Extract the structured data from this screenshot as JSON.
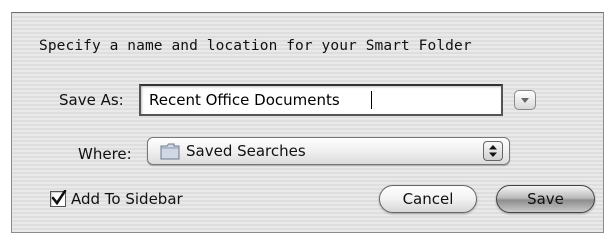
{
  "dialog": {
    "prompt": "Specify a name and location for your Smart Folder",
    "save_as": {
      "label": "Save As:",
      "value": "Recent Office Documents"
    },
    "disclosure_icon": "triangle-down-icon",
    "where": {
      "label": "Where:",
      "selected": "Saved Searches",
      "icon": "folder-icon"
    },
    "add_to_sidebar": {
      "label": "Add To Sidebar",
      "checked": true
    },
    "buttons": {
      "cancel": "Cancel",
      "save": "Save"
    }
  }
}
